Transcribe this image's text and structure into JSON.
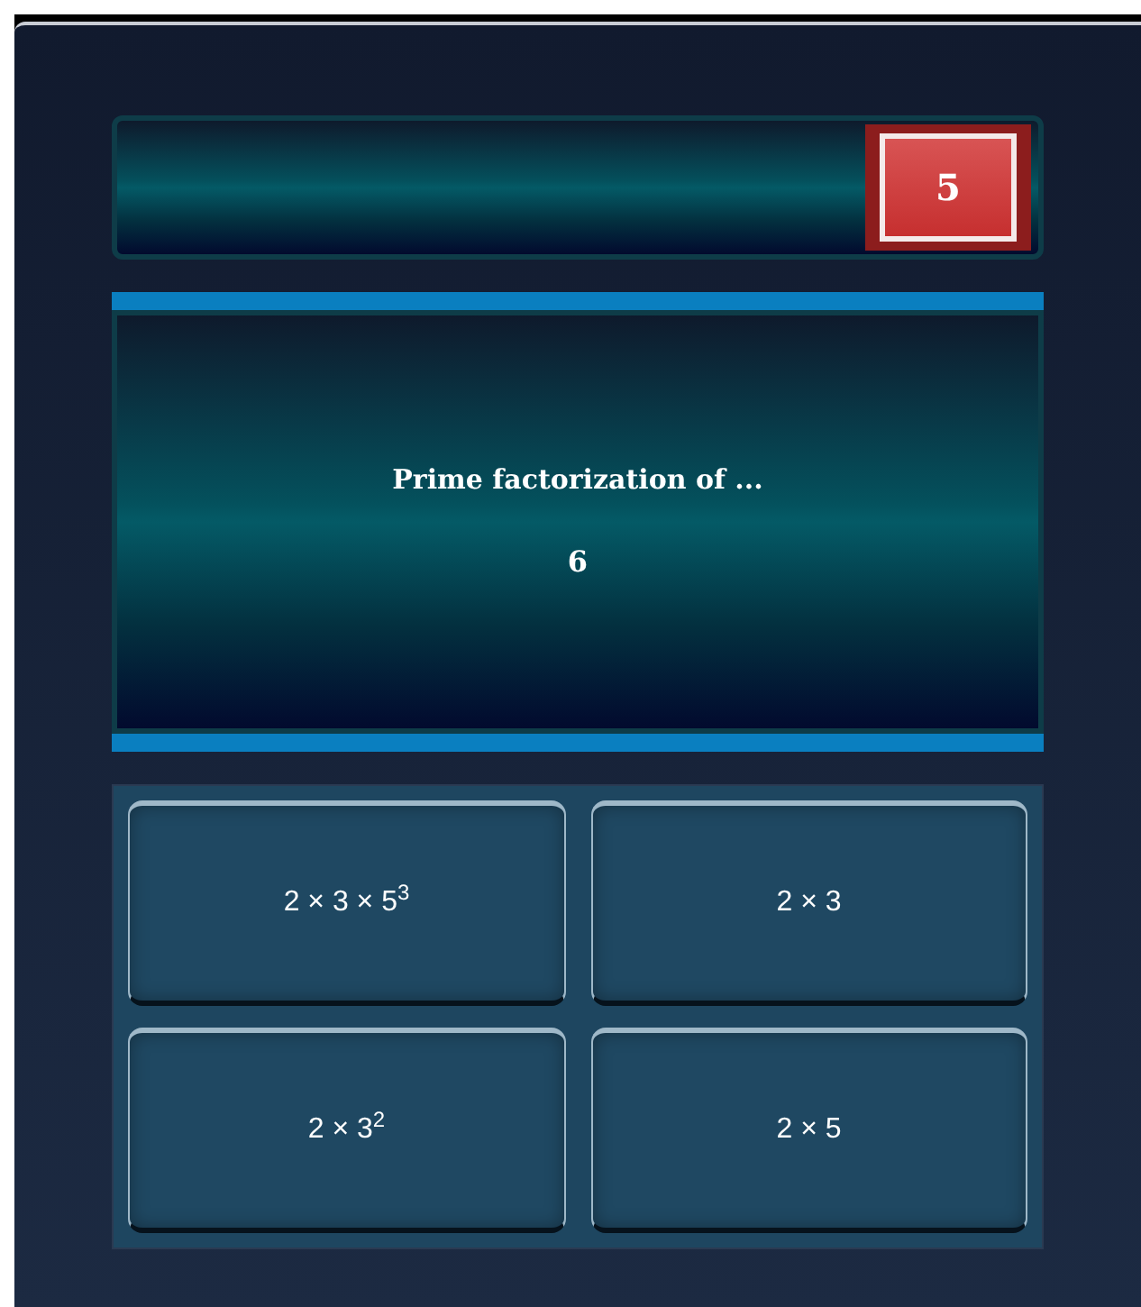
{
  "timer": {
    "value": "5"
  },
  "question": {
    "prompt": "Prime factorization of ...",
    "number": "6"
  },
  "answers": [
    {
      "text": "2 × 3 × 5$^{3}$"
    },
    {
      "text": "2 × 3"
    },
    {
      "text": "2 × 3$^{2}$"
    },
    {
      "text": "2 × 5"
    }
  ]
}
